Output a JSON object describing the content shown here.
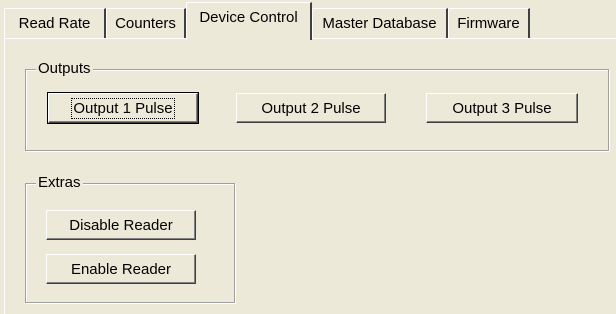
{
  "tabs": [
    {
      "label": "Read Rate",
      "active": false
    },
    {
      "label": "Counters",
      "active": false
    },
    {
      "label": "Device Control",
      "active": true
    },
    {
      "label": "Master Database",
      "active": false
    },
    {
      "label": "Firmware",
      "active": false
    }
  ],
  "outputs": {
    "caption": "Outputs",
    "buttons": [
      "Output 1 Pulse",
      "Output 2 Pulse",
      "Output 3 Pulse"
    ]
  },
  "extras": {
    "caption": "Extras",
    "buttons": [
      "Disable Reader",
      "Enable Reader"
    ]
  }
}
